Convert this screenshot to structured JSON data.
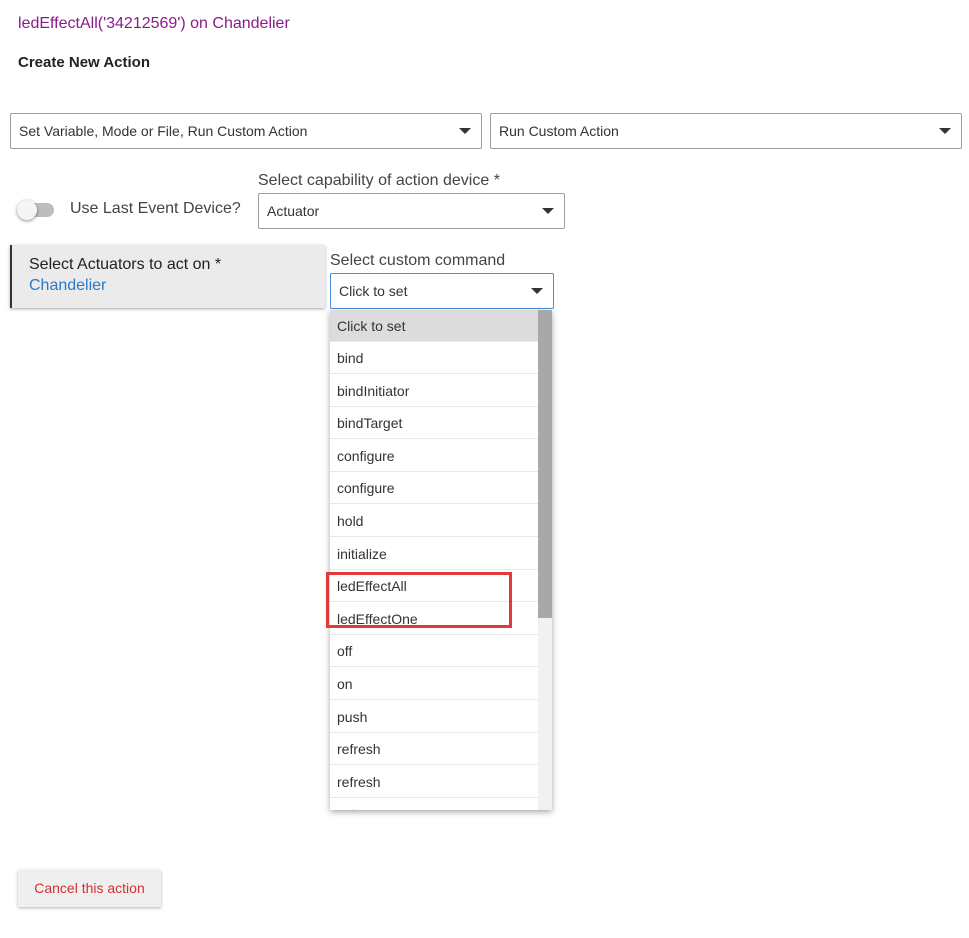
{
  "header": {
    "title_link": "ledEffectAll('34212569') on Chandelier",
    "section_title": "Create New Action"
  },
  "action_category_select": {
    "value": "Set Variable, Mode or File, Run Custom Action"
  },
  "action_type_select": {
    "value": "Run Custom Action"
  },
  "use_last_event_device": {
    "label": "Use Last Event Device?",
    "checked": false
  },
  "capability": {
    "label": "Select capability of action device *",
    "value": "Actuator"
  },
  "actuators": {
    "label": "Select Actuators to act on *",
    "value": "Chandelier"
  },
  "custom_command": {
    "label": "Select custom command",
    "value": "Click to set",
    "options": [
      "Click to set",
      "bind",
      "bindInitiator",
      "bindTarget",
      "configure",
      "configure",
      "hold",
      "initialize",
      "ledEffectAll",
      "ledEffectOne",
      "off",
      "on",
      "push",
      "refresh",
      "refresh",
      "set"
    ],
    "highlighted_options": [
      "ledEffectAll",
      "ledEffectOne"
    ]
  },
  "cancel_button": {
    "label": "Cancel this action"
  },
  "colors": {
    "title": "#8b1a8b",
    "link": "#2a7ac7",
    "cancel": "#d32f2f",
    "highlight_box": "#e03a3a"
  },
  "icons": {
    "dropdown": "caret-down-icon"
  }
}
